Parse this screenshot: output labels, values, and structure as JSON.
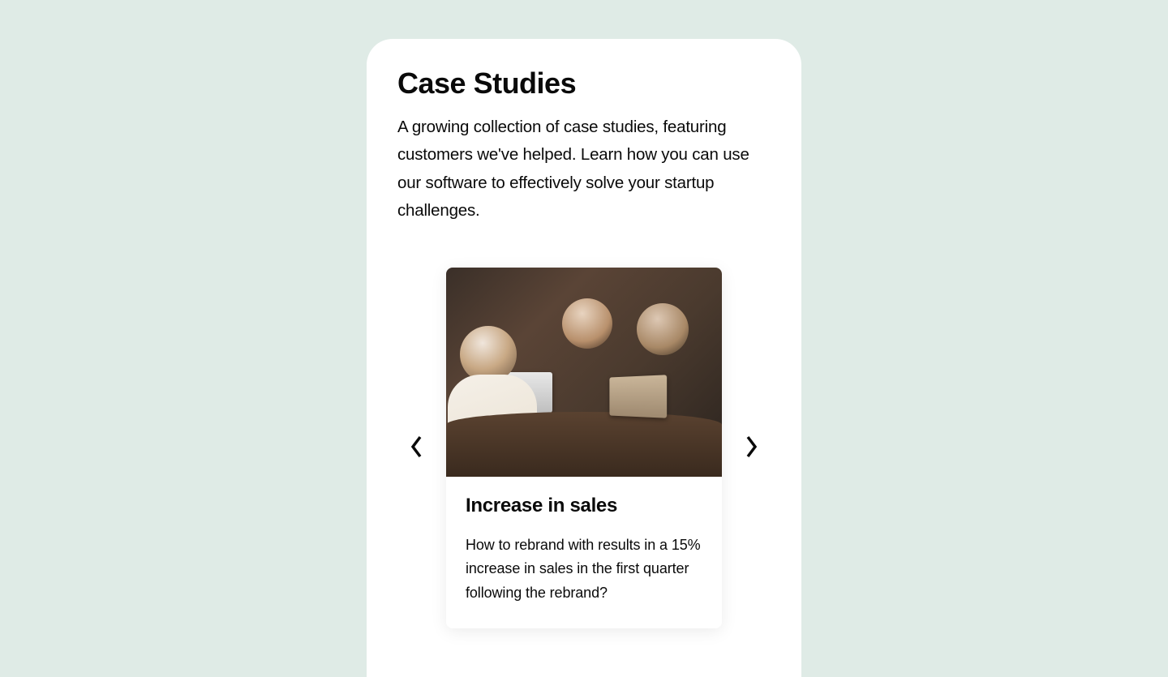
{
  "header": {
    "title": "Case Studies",
    "description": "A growing collection of case studies, featuring customers we've helped. Learn how you can use our software to effectively solve your startup challenges."
  },
  "carousel": {
    "current_slide": {
      "image_alt": "Three people collaborating at a table with laptops",
      "title": "Increase in sales",
      "text": "How to rebrand with results in a 15% increase in sales in the first quarter following the rebrand?"
    }
  },
  "icons": {
    "prev": "chevron-left",
    "next": "chevron-right"
  },
  "colors": {
    "page_bg": "#dfebe6",
    "card_bg": "#ffffff",
    "text_primary": "#0a0a0a"
  }
}
